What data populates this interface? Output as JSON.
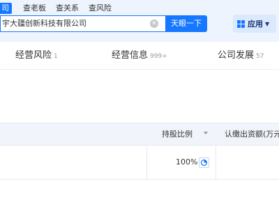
{
  "nav": {
    "tabs": [
      {
        "label": "司",
        "active": true
      },
      {
        "label": "查老板",
        "active": false
      },
      {
        "label": "查关系",
        "active": false
      },
      {
        "label": "查风险",
        "active": false
      }
    ]
  },
  "search": {
    "value": "宇大疆创新科技有限公司",
    "button_label": "天眼一下"
  },
  "apps": {
    "label": "应用",
    "icon": "grid-icon"
  },
  "tabs": [
    {
      "label": "经营风险",
      "count": "1"
    },
    {
      "label": "经营信息",
      "count": "999+"
    },
    {
      "label": "公司发展",
      "count": "57"
    }
  ],
  "table": {
    "headers": {
      "share_ratio": "持股比例",
      "subscribed": "认缴出资额(万元"
    },
    "rows": [
      {
        "share_ratio": "100%"
      }
    ]
  },
  "colors": {
    "accent": "#1677ff",
    "topbar_bg": "#eef4fd",
    "header_bg": "#f1f5fb"
  }
}
